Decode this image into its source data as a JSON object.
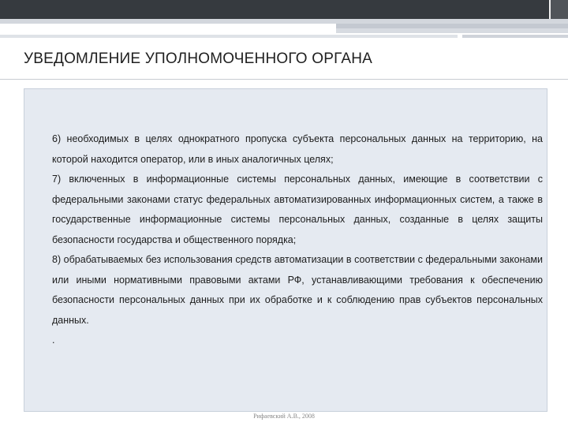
{
  "slide": {
    "title": "УВЕДОМЛЕНИЕ УПОЛНОМОЧЕННОГО ОРГАНА",
    "items": [
      "6) необходимых в целях однократного пропуска субъекта персональных данных на территорию, на которой находится оператор, или в иных аналогичных целях;",
      "7) включенных в информационные системы персональных данных, имеющие в соответствии с федеральными законами статус федеральных автоматизированных информационных систем, а также в государственные информационные системы персональных данных, созданные в целях защиты безопасности государства и общественного порядка;",
      "8) обрабатываемых без использования средств автоматизации в соответствии с федеральными законами или иными нормативными правовыми актами РФ, устанавливающими требования к обеспечению безопасности персональных данных при их обработке и к соблюдению прав субъектов персональных данных."
    ],
    "trailing_mark": ".",
    "footer": "Рифаевский А.В., 2008"
  }
}
